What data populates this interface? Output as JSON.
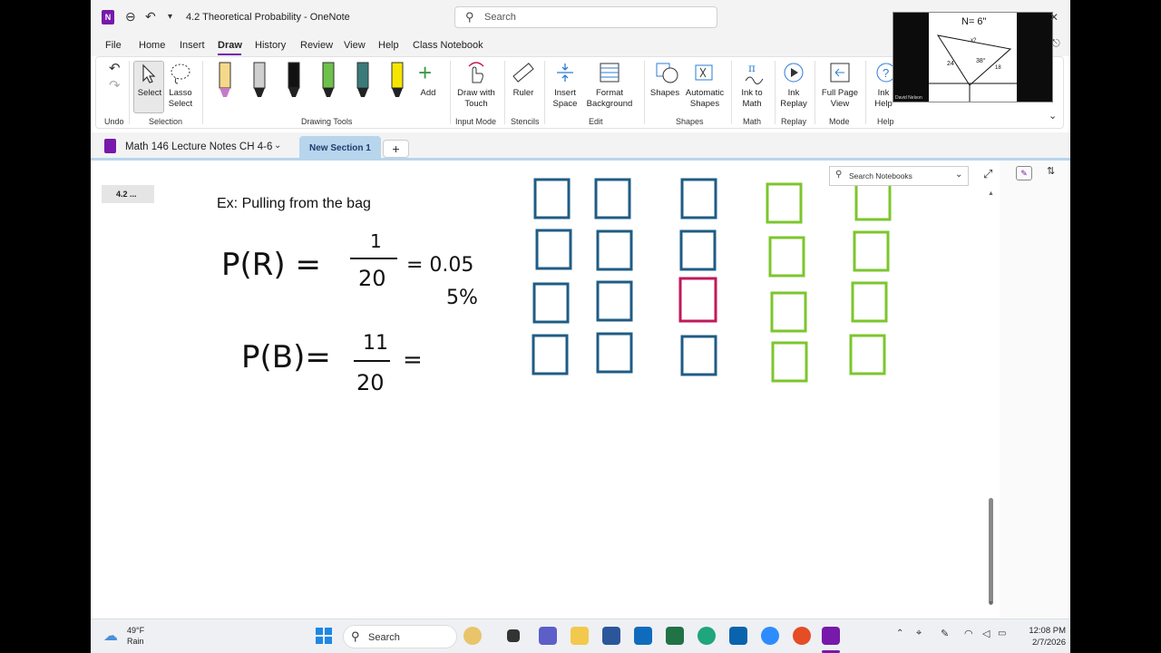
{
  "window": {
    "doc_title": "4.2  Theoretical Probability  -  OneNote",
    "search_placeholder": "Search"
  },
  "menu": [
    "File",
    "Home",
    "Insert",
    "Draw",
    "History",
    "Review",
    "View",
    "Help",
    "Class Notebook"
  ],
  "menu_active": "Draw",
  "ribbon": {
    "select": "Select",
    "lasso": "Lasso\nSelect",
    "add": "Add",
    "draw_touch": "Draw with\nTouch",
    "ruler": "Ruler",
    "insert_space": "Insert\nSpace",
    "format_bg": "Format\nBackground",
    "shapes": "Shapes",
    "auto_shapes": "Automatic\nShapes",
    "ink_math": "Ink to\nMath",
    "ink_replay": "Ink\nReplay",
    "full_page": "Full Page\nView",
    "ink_help": "Ink\nHelp",
    "groups": {
      "undo": "Undo",
      "selection": "Selection",
      "drawing_tools": "Drawing Tools",
      "input_mode": "Input Mode",
      "stencils": "Stencils",
      "edit": "Edit",
      "shapes": "Shapes",
      "math": "Math",
      "replay": "Replay",
      "mode": "Mode",
      "help": "Help"
    },
    "pen_colors": [
      "#f5d98a",
      "#cfcfcf",
      "#111111",
      "#6cc24a",
      "#3a7a7a",
      "#f5e600"
    ]
  },
  "notebook": {
    "name": "Math 146 Lecture Notes CH 4-6",
    "section": "New Section 1",
    "search_notebooks": "Search Notebooks",
    "page_item": "4.2  ..."
  },
  "note": {
    "heading": "Ex:  Pulling from the bag",
    "pr_label": "P(R)  =",
    "pr_num": "1",
    "pr_den": "20",
    "pr_eq": "= 0.05",
    "pr_pct": "5%",
    "pb_label": "P(B)=",
    "pb_num": "11",
    "pb_den": "20",
    "pb_eq": "="
  },
  "squares": {
    "colors": {
      "blue": "#1f5c85",
      "red": "#c2185b",
      "green": "#7cc62d"
    }
  },
  "taskbar": {
    "temp": "49°F",
    "weather": "Rain",
    "search": "Search",
    "time": "12:08 PM",
    "date": "2/7/2026"
  },
  "video": {
    "caption": "David Nelson",
    "n_label": "N= 6\"",
    "angle": "38°",
    "x": "x?",
    "s1": "24",
    "s2": "18"
  }
}
